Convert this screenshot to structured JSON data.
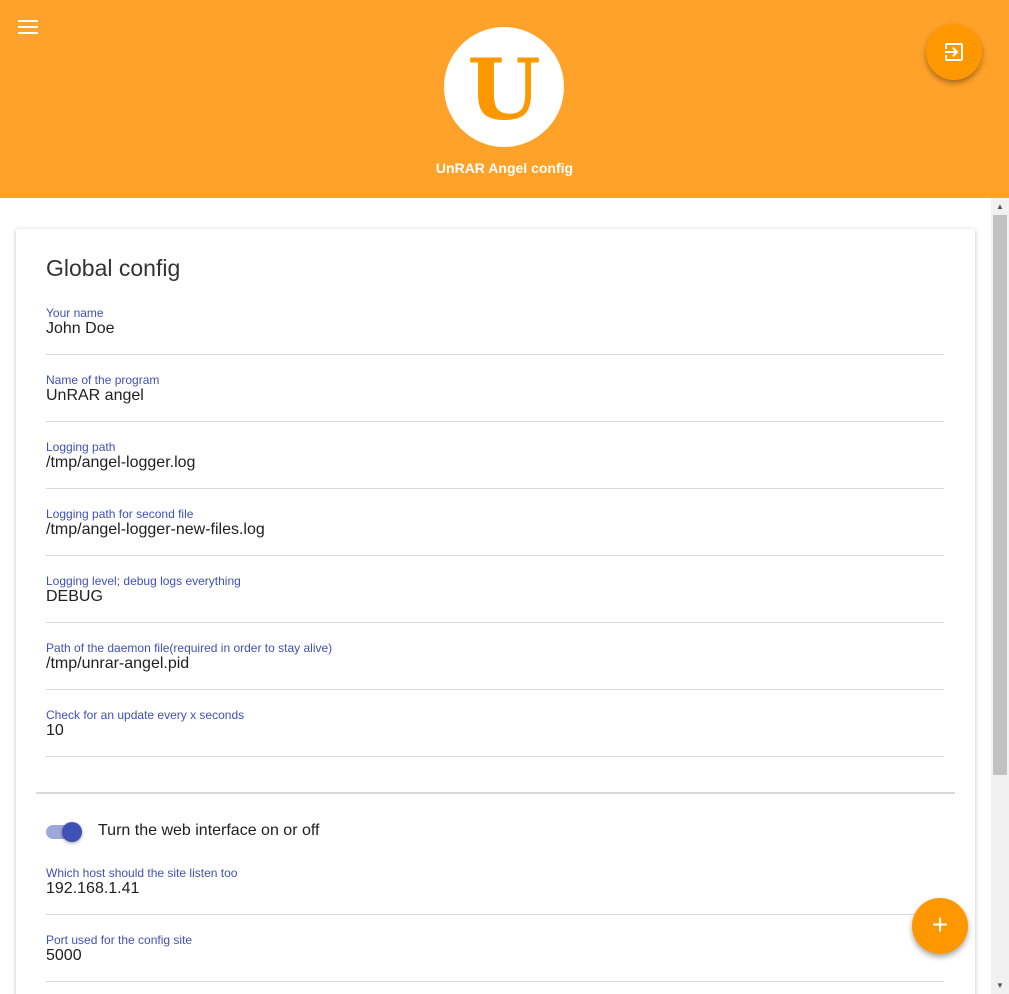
{
  "header": {
    "title": "UnRAR Angel config",
    "logo_letter": "U",
    "menu_icon": "menu-icon",
    "exit_icon": "exit-to-app-icon",
    "color": "#ffa229"
  },
  "card": {
    "title": "Global config",
    "fields": [
      {
        "label": "Your name",
        "value": "John Doe"
      },
      {
        "label": "Name of the program",
        "value": "UnRAR angel"
      },
      {
        "label": "Logging path",
        "value": "/tmp/angel-logger.log"
      },
      {
        "label": "Logging path for second file",
        "value": "/tmp/angel-logger-new-files.log"
      },
      {
        "label": "Logging level; debug logs everything",
        "value": "DEBUG"
      },
      {
        "label": "Path of the daemon file(required in order to stay alive)",
        "value": "/tmp/unrar-angel.pid"
      },
      {
        "label": "Check for an update every x seconds",
        "value": "10"
      }
    ],
    "web": {
      "toggle_label": "Turn the web interface on or off",
      "toggle_on": true,
      "fields": [
        {
          "label": "Which host should the site listen too",
          "value": "192.168.1.41"
        },
        {
          "label": "Port used for the config site",
          "value": "5000"
        }
      ]
    }
  },
  "fab": {
    "label": "+",
    "icon": "add-icon"
  },
  "accent": "#3f51b5"
}
